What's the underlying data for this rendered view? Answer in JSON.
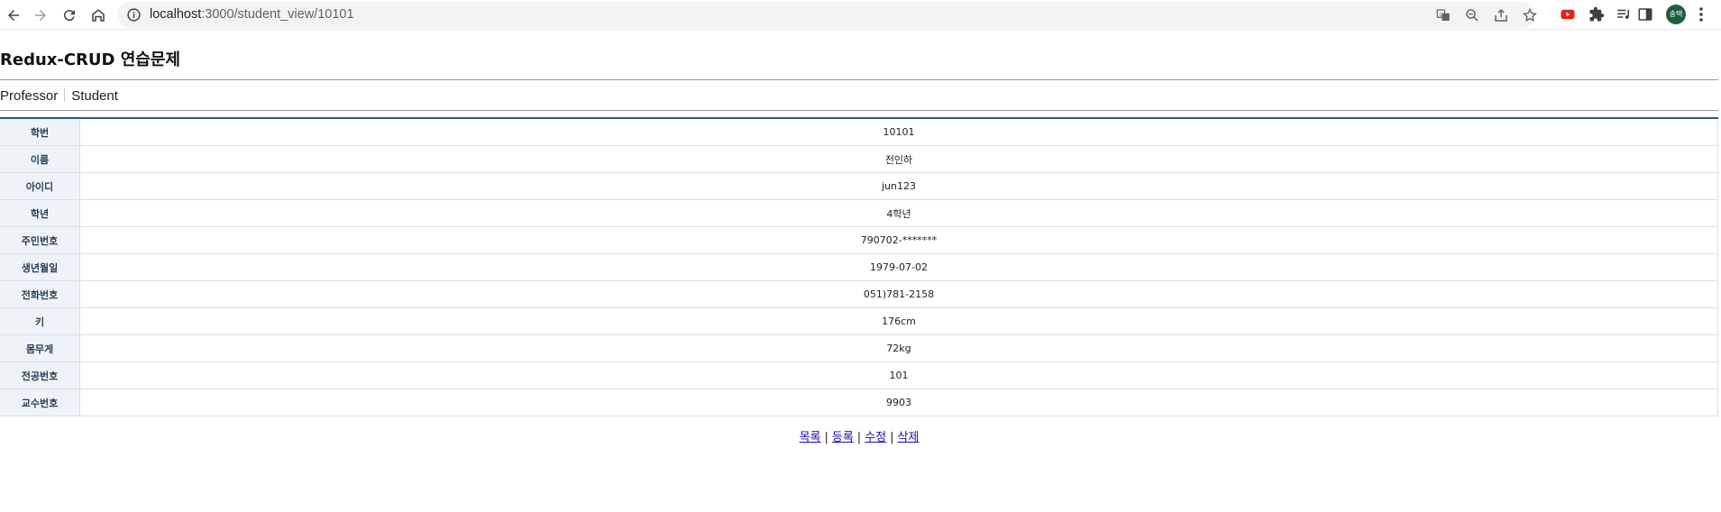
{
  "browser": {
    "url_host": "localhost",
    "url_path": ":3000/student_view/10101",
    "avatar_text": "송택",
    "icons": [
      "back-icon",
      "forward-icon",
      "reload-icon",
      "home-icon",
      "info-icon",
      "translate-icon",
      "zoom-icon",
      "share-icon",
      "bookmark-star-icon",
      "youtube-extension-icon",
      "extensions-puzzle-icon",
      "reading-list-icon",
      "side-panel-icon",
      "menu-dots-icon"
    ]
  },
  "page": {
    "title": "Redux-CRUD 연습문제",
    "nav": [
      {
        "label": "Professor"
      },
      {
        "label": "Student"
      }
    ]
  },
  "student": {
    "rows": [
      {
        "label": "학번",
        "value": "10101"
      },
      {
        "label": "이름",
        "value": "전인하"
      },
      {
        "label": "아이디",
        "value": "jun123"
      },
      {
        "label": "학년",
        "value": "4학년"
      },
      {
        "label": "주민번호",
        "value": "790702-*******"
      },
      {
        "label": "생년월일",
        "value": "1979-07-02"
      },
      {
        "label": "전화번호",
        "value": "051)781-2158"
      },
      {
        "label": "키",
        "value": "176cm"
      },
      {
        "label": "몸무게",
        "value": "72kg"
      },
      {
        "label": "전공번호",
        "value": "101"
      },
      {
        "label": "교수번호",
        "value": "9903"
      }
    ]
  },
  "actions": {
    "list": "목록",
    "create": "등록",
    "edit": "수정",
    "delete": "삭제",
    "separator": "|"
  },
  "colors": {
    "table_header_bg": "#eef3f8",
    "table_top_border": "#2a5d73",
    "link": "#1a0dab"
  }
}
